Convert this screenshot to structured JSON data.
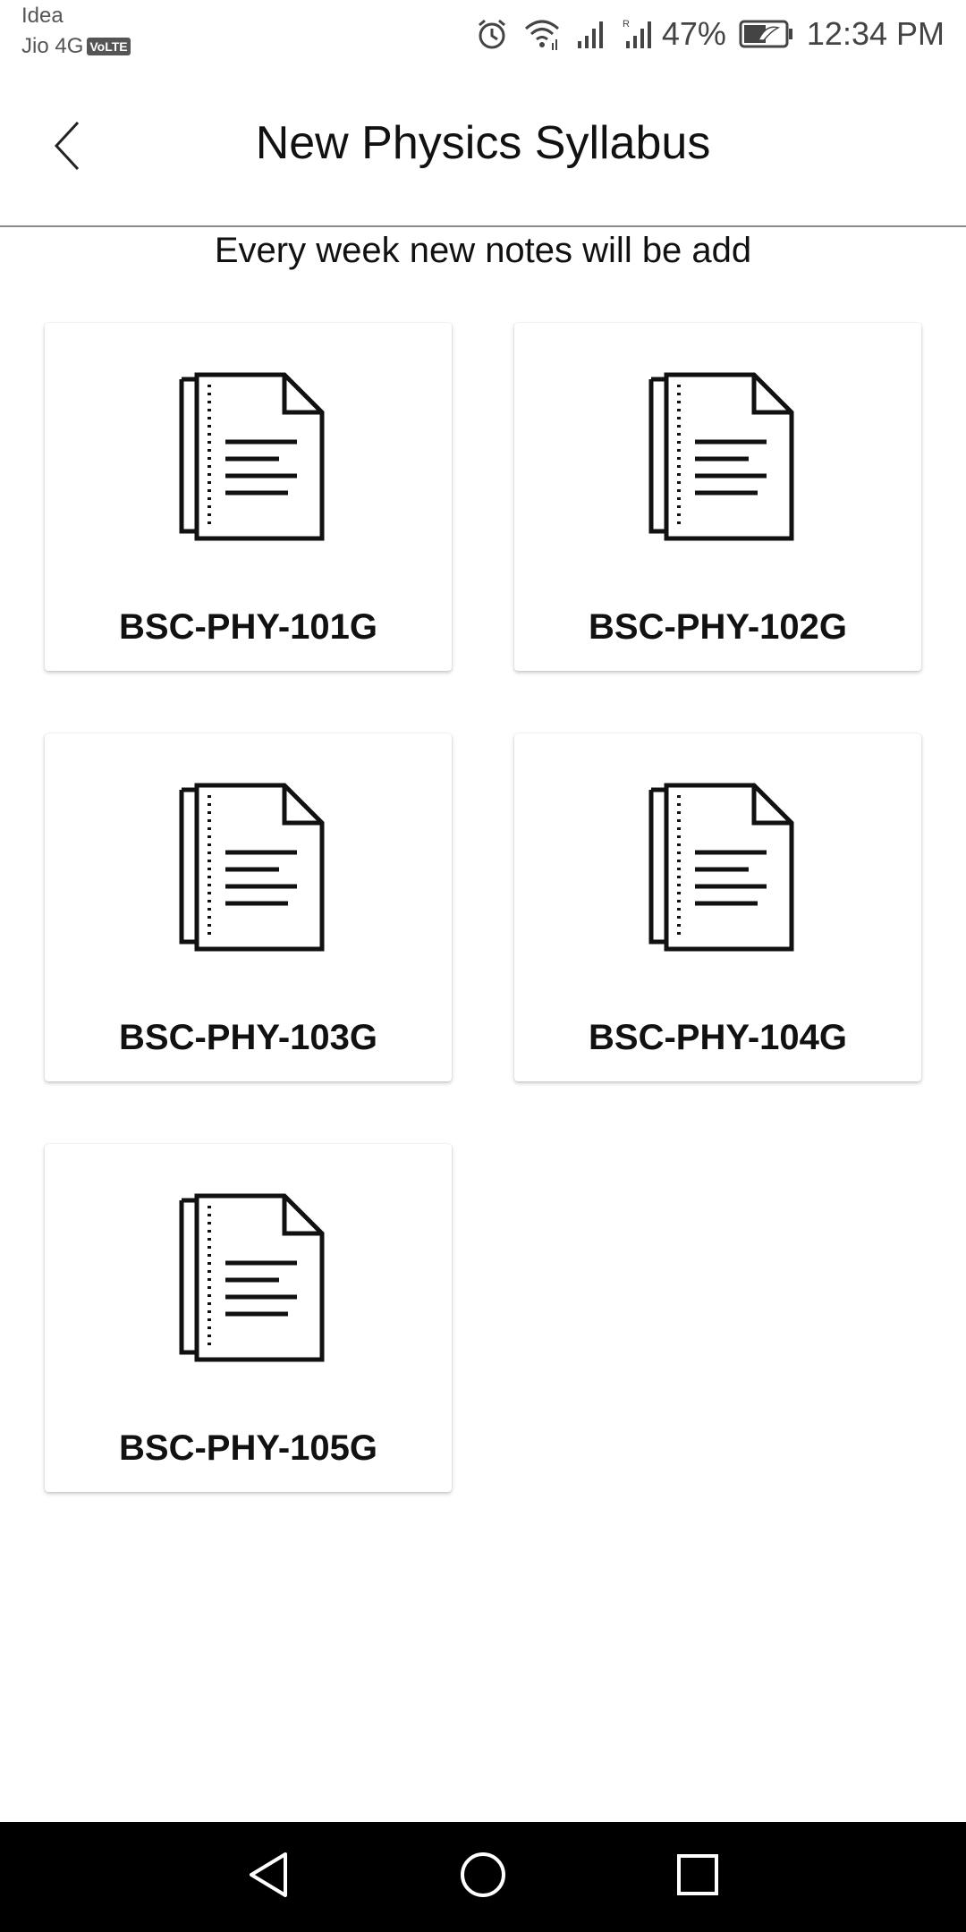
{
  "status_bar": {
    "carrier_1": "Idea",
    "carrier_2": "Jio 4G",
    "volte_badge": "VoLTE",
    "battery_percent": "47%",
    "time": "12:34 PM",
    "icons": [
      "alarm-icon",
      "wifi-icon",
      "signal-icon",
      "signal-roaming-icon",
      "battery-icon"
    ]
  },
  "header": {
    "title": "New Physics Syllabus",
    "back_icon": "chevron-left-icon"
  },
  "subtitle": "Every week new notes will be add",
  "cards": [
    {
      "label": "BSC-PHY-101G",
      "icon": "document-icon"
    },
    {
      "label": "BSC-PHY-102G",
      "icon": "document-icon"
    },
    {
      "label": "BSC-PHY-103G",
      "icon": "document-icon"
    },
    {
      "label": "BSC-PHY-104G",
      "icon": "document-icon"
    },
    {
      "label": "BSC-PHY-105G",
      "icon": "document-icon"
    }
  ],
  "nav_bar": {
    "buttons": [
      "back-triangle-icon",
      "home-circle-icon",
      "recents-square-icon"
    ]
  },
  "colors": {
    "background": "#ffffff",
    "text": "#111111",
    "nav_bar": "#000000",
    "divider": "#8a8a8a"
  }
}
